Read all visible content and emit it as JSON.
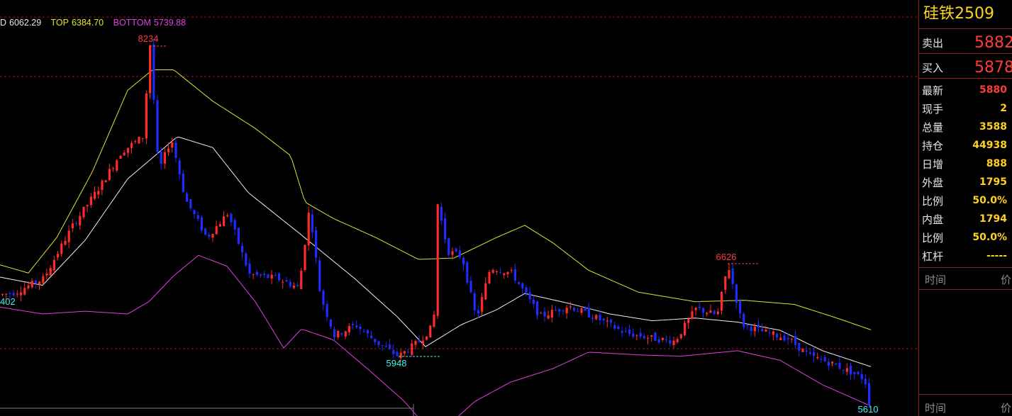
{
  "indicator": {
    "mid": {
      "label": "D",
      "value": "6062.29",
      "color": "#e8e8e8"
    },
    "top": {
      "label": "TOP",
      "value": "6384.70",
      "color": "#e2e22a"
    },
    "bottom": {
      "label": "BOTTOM",
      "value": "5739.88",
      "color": "#e040e0"
    }
  },
  "annotations": {
    "high": "8234",
    "left": "402",
    "low1": "5948",
    "peak2": "6626",
    "low2": "5610"
  },
  "quote": {
    "symbol": "硅铁2509",
    "sell": {
      "label": "卖出",
      "price": "5882"
    },
    "buy": {
      "label": "买入",
      "price": "5878"
    },
    "stats": [
      {
        "label": "最新",
        "value": "5880",
        "color": "#ff3b3b"
      },
      {
        "label": "现手",
        "value": "2",
        "color": "#ffd21e"
      },
      {
        "label": "总量",
        "value": "3588",
        "color": "#ffd21e"
      },
      {
        "label": "持仓",
        "value": "44938",
        "color": "#ffd21e"
      },
      {
        "label": "日增",
        "value": "888",
        "color": "#ffd21e"
      },
      {
        "label": "外盘",
        "value": "1795",
        "color": "#ffd21e"
      },
      {
        "label": "比例",
        "value": "50.0%",
        "color": "#ffd21e"
      },
      {
        "label": "内盘",
        "value": "1794",
        "color": "#ffd21e"
      },
      {
        "label": "比例",
        "value": "50.0%",
        "color": "#ffd21e"
      },
      {
        "label": "杠杆",
        "value": "-----",
        "color": "#ffd21e"
      }
    ],
    "table_head": {
      "time": "时间",
      "price": "价"
    },
    "footer": {
      "time": "时间",
      "price": "价"
    }
  },
  "colors": {
    "up": "#ff2a2a",
    "down": "#1f2bff",
    "mid": "#f0f0f0",
    "top": "#e2e22a",
    "bottom": "#e040e0",
    "grid": "#8b1a1a"
  },
  "chart_data": {
    "type": "candlestick",
    "price_range": [
      5600,
      8250
    ],
    "anchors": [
      [
        0,
        6400
      ],
      [
        20,
        6420
      ],
      [
        60,
        6520
      ],
      [
        100,
        6900
      ],
      [
        140,
        7200
      ],
      [
        170,
        7450
      ],
      [
        200,
        7560
      ],
      [
        210,
        8234
      ],
      [
        222,
        7300
      ],
      [
        240,
        7550
      ],
      [
        260,
        7100
      ],
      [
        290,
        6820
      ],
      [
        320,
        7000
      ],
      [
        350,
        6550
      ],
      [
        390,
        6520
      ],
      [
        420,
        6450
      ],
      [
        435,
        7050
      ],
      [
        450,
        6400
      ],
      [
        470,
        6100
      ],
      [
        500,
        6180
      ],
      [
        530,
        6050
      ],
      [
        560,
        5948
      ],
      [
        590,
        6060
      ],
      [
        610,
        6180
      ],
      [
        615,
        7080
      ],
      [
        630,
        6720
      ],
      [
        650,
        6680
      ],
      [
        670,
        6220
      ],
      [
        690,
        6600
      ],
      [
        720,
        6560
      ],
      [
        760,
        6240
      ],
      [
        800,
        6320
      ],
      [
        840,
        6230
      ],
      [
        880,
        6120
      ],
      [
        920,
        6080
      ],
      [
        950,
        6060
      ],
      [
        980,
        6300
      ],
      [
        1010,
        6250
      ],
      [
        1025,
        6626
      ],
      [
        1045,
        6180
      ],
      [
        1080,
        6120
      ],
      [
        1110,
        6080
      ],
      [
        1140,
        5950
      ],
      [
        1170,
        5900
      ],
      [
        1200,
        5830
      ],
      [
        1218,
        5780
      ],
      [
        1224,
        5610
      ],
      [
        1230,
        5880
      ]
    ],
    "bands": {
      "mid": [
        [
          0,
          6530
        ],
        [
          60,
          6470
        ],
        [
          120,
          6800
        ],
        [
          180,
          7250
        ],
        [
          250,
          7560
        ],
        [
          300,
          7480
        ],
        [
          350,
          7150
        ],
        [
          420,
          6860
        ],
        [
          500,
          6520
        ],
        [
          560,
          6240
        ],
        [
          600,
          6020
        ],
        [
          650,
          6180
        ],
        [
          700,
          6290
        ],
        [
          740,
          6410
        ],
        [
          800,
          6340
        ],
        [
          860,
          6260
        ],
        [
          920,
          6210
        ],
        [
          980,
          6230
        ],
        [
          1040,
          6200
        ],
        [
          1100,
          6140
        ],
        [
          1160,
          5990
        ],
        [
          1230,
          5870
        ]
      ],
      "top": [
        [
          0,
          6620
        ],
        [
          40,
          6560
        ],
        [
          80,
          6820
        ],
        [
          130,
          7300
        ],
        [
          180,
          7900
        ],
        [
          215,
          8050
        ],
        [
          245,
          8050
        ],
        [
          300,
          7820
        ],
        [
          360,
          7620
        ],
        [
          410,
          7420
        ],
        [
          430,
          7080
        ],
        [
          470,
          6960
        ],
        [
          530,
          6820
        ],
        [
          590,
          6660
        ],
        [
          640,
          6670
        ],
        [
          700,
          6820
        ],
        [
          740,
          6910
        ],
        [
          780,
          6780
        ],
        [
          830,
          6580
        ],
        [
          900,
          6420
        ],
        [
          980,
          6350
        ],
        [
          1050,
          6360
        ],
        [
          1120,
          6330
        ],
        [
          1180,
          6230
        ],
        [
          1230,
          6140
        ]
      ],
      "bottom": [
        [
          0,
          6310
        ],
        [
          60,
          6260
        ],
        [
          120,
          6280
        ],
        [
          180,
          6260
        ],
        [
          210,
          6350
        ],
        [
          245,
          6540
        ],
        [
          280,
          6690
        ],
        [
          320,
          6610
        ],
        [
          360,
          6350
        ],
        [
          400,
          6010
        ],
        [
          425,
          6150
        ],
        [
          470,
          6070
        ],
        [
          520,
          5850
        ],
        [
          570,
          5620
        ],
        [
          600,
          5440
        ],
        [
          640,
          5480
        ],
        [
          670,
          5620
        ],
        [
          720,
          5760
        ],
        [
          780,
          5860
        ],
        [
          830,
          5980
        ],
        [
          900,
          5960
        ],
        [
          960,
          5950
        ],
        [
          1040,
          5990
        ],
        [
          1100,
          5920
        ],
        [
          1160,
          5740
        ],
        [
          1230,
          5580
        ]
      ]
    }
  }
}
